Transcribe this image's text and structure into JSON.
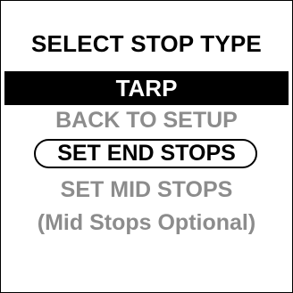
{
  "screen": {
    "title": "SELECT STOP TYPE",
    "selected_type": "TARP",
    "menu": {
      "back_label": "BACK TO SETUP",
      "end_stops_label": "SET END STOPS",
      "mid_stops_label": "SET MID STOPS",
      "mid_stops_note": "(Mid Stops Optional)"
    }
  },
  "colors": {
    "background": "#ffffff",
    "text": "#000000",
    "selected_bar": "#000000",
    "selected_text": "#ffffff",
    "dimmed_text": "#8c8c8c"
  }
}
